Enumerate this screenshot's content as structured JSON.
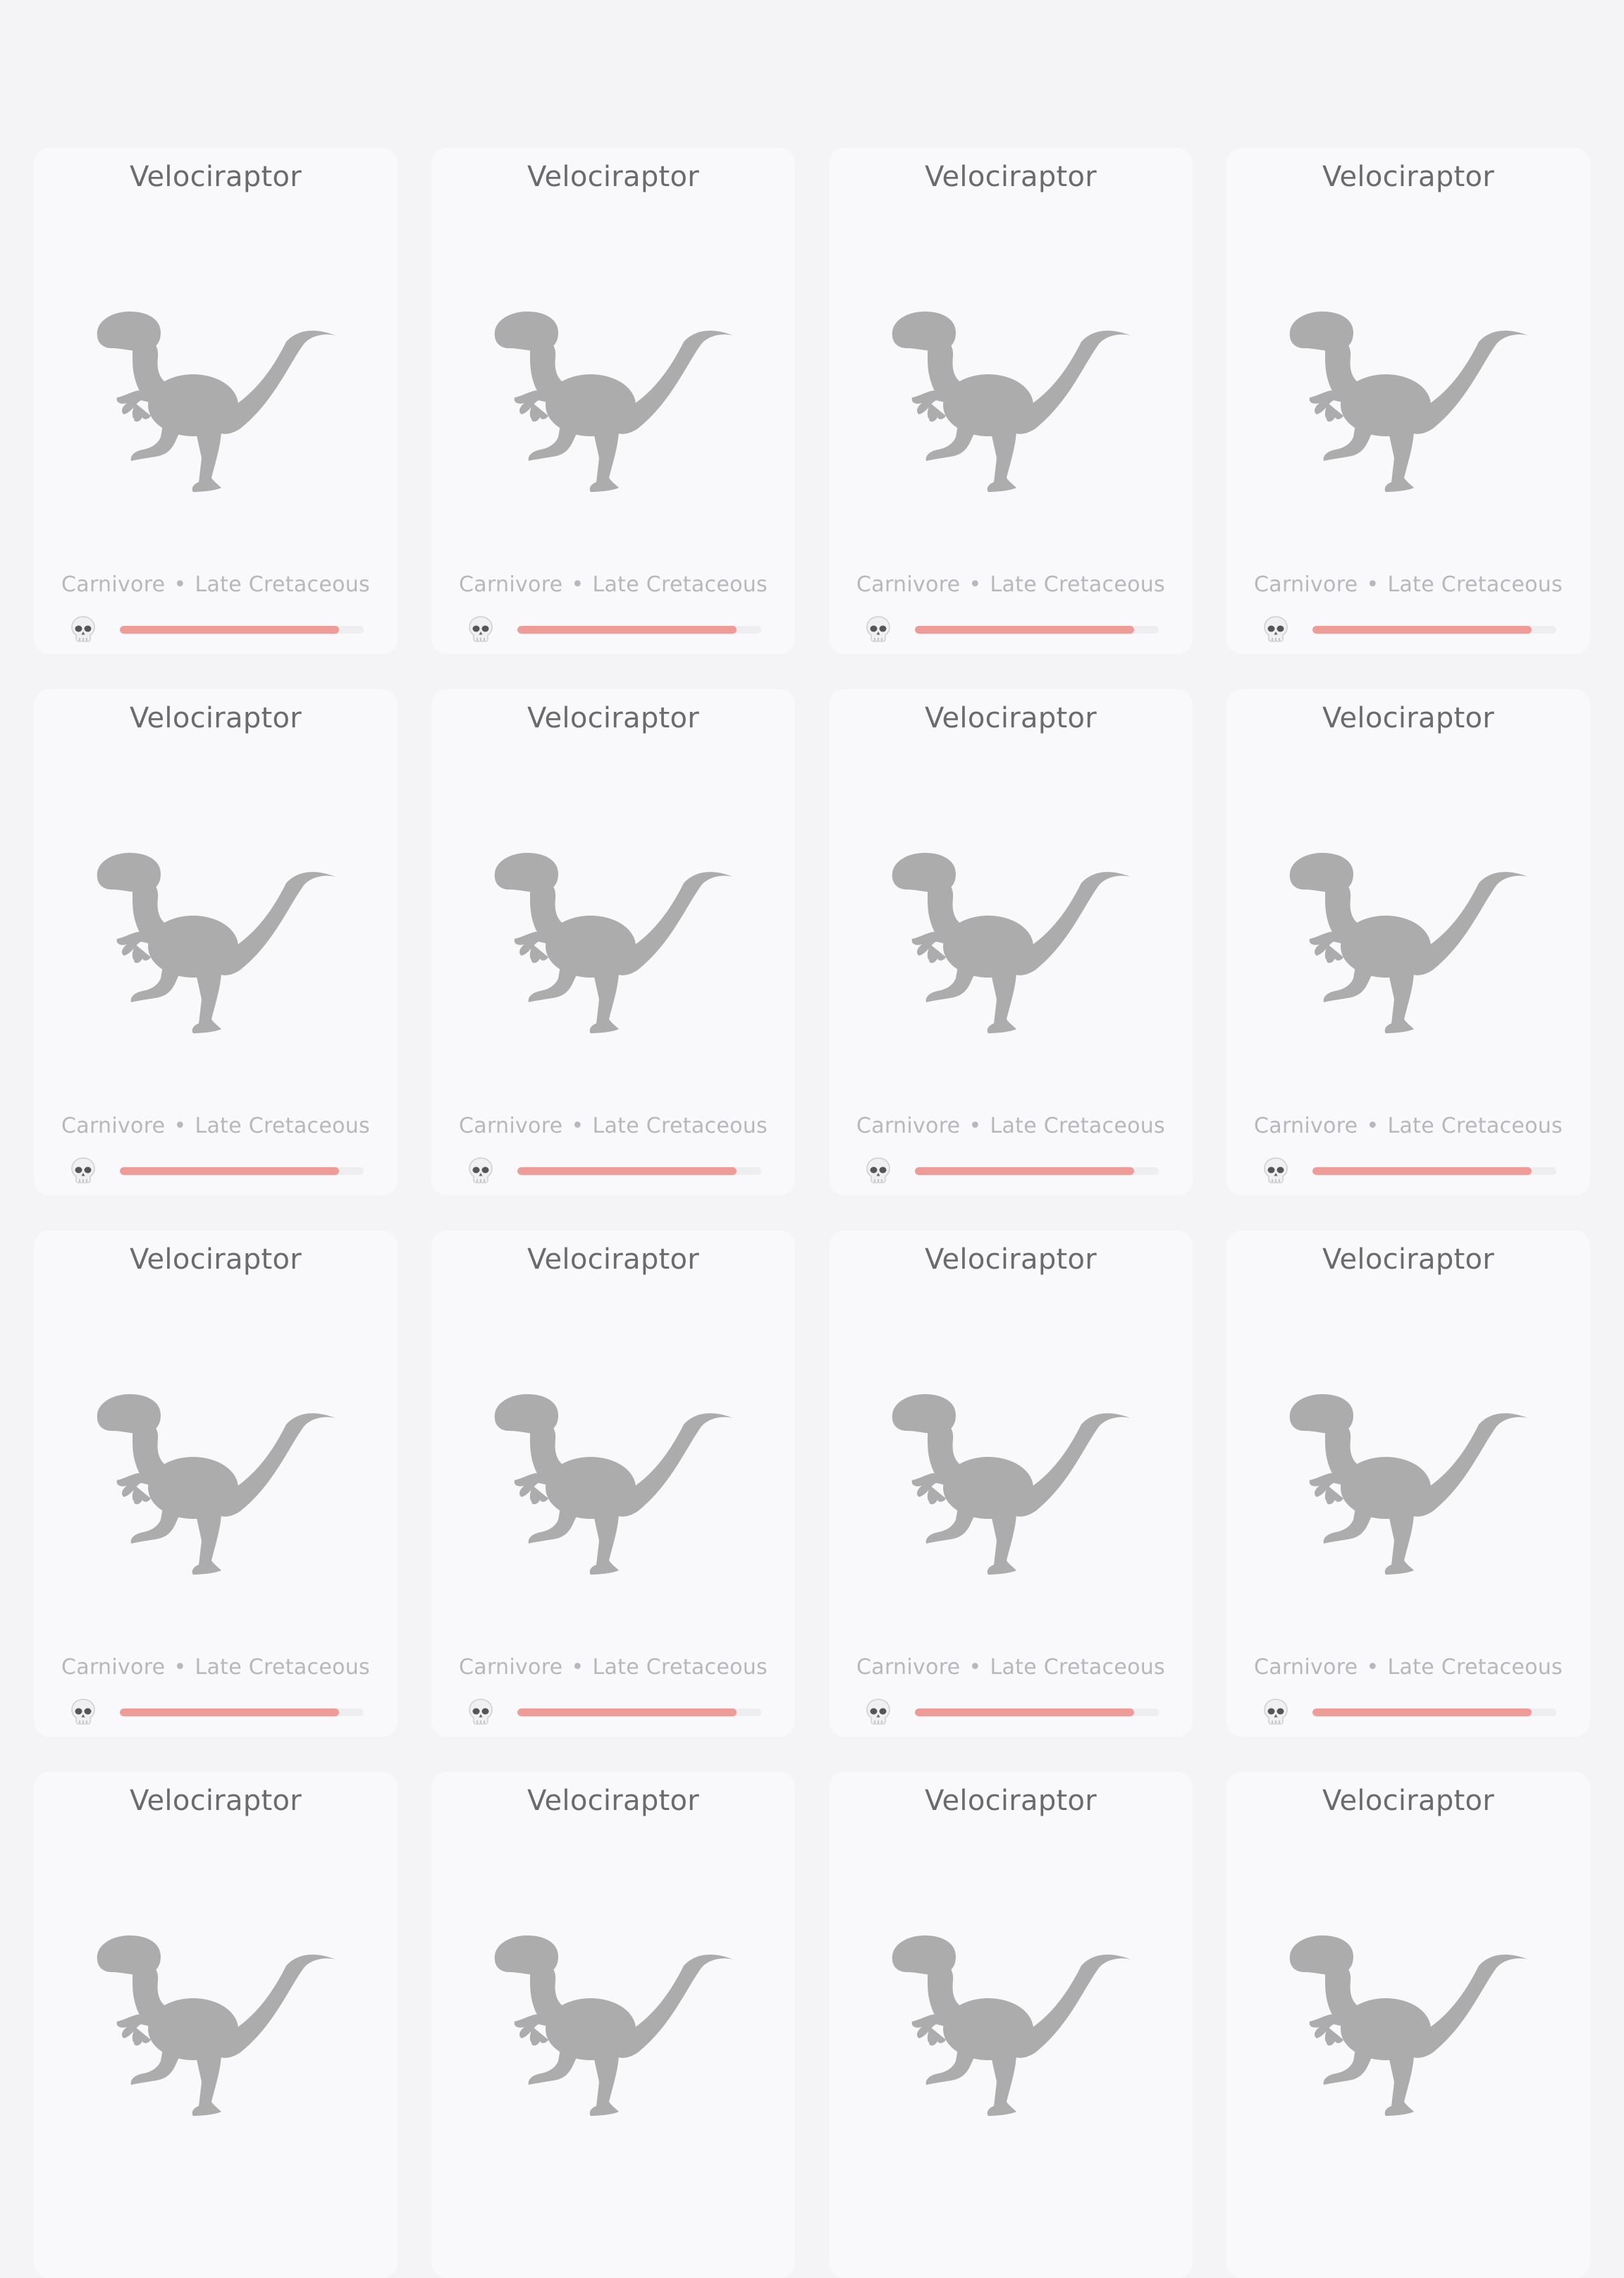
{
  "colors": {
    "background": "#f4f4f7",
    "card": "#f9f9fb",
    "title_text": "#6b6b6b",
    "meta_text": "#b8b8bc",
    "silhouette": "#acacac",
    "danger_bar_fill": "#ef9c99",
    "danger_bar_track": "#eeeef1"
  },
  "cards": [
    {
      "name": "Velociraptor",
      "diet": "Carnivore",
      "separator": "•",
      "period": "Late Cretaceous",
      "image_icon": "velociraptor-silhouette",
      "danger_icon": "skull-icon",
      "danger_level": 0.9
    },
    {
      "name": "Velociraptor",
      "diet": "Carnivore",
      "separator": "•",
      "period": "Late Cretaceous",
      "image_icon": "velociraptor-silhouette",
      "danger_icon": "skull-icon",
      "danger_level": 0.9
    },
    {
      "name": "Velociraptor",
      "diet": "Carnivore",
      "separator": "•",
      "period": "Late Cretaceous",
      "image_icon": "velociraptor-silhouette",
      "danger_icon": "skull-icon",
      "danger_level": 0.9
    },
    {
      "name": "Velociraptor",
      "diet": "Carnivore",
      "separator": "•",
      "period": "Late Cretaceous",
      "image_icon": "velociraptor-silhouette",
      "danger_icon": "skull-icon",
      "danger_level": 0.9
    },
    {
      "name": "Velociraptor",
      "diet": "Carnivore",
      "separator": "•",
      "period": "Late Cretaceous",
      "image_icon": "velociraptor-silhouette",
      "danger_icon": "skull-icon",
      "danger_level": 0.9
    },
    {
      "name": "Velociraptor",
      "diet": "Carnivore",
      "separator": "•",
      "period": "Late Cretaceous",
      "image_icon": "velociraptor-silhouette",
      "danger_icon": "skull-icon",
      "danger_level": 0.9
    },
    {
      "name": "Velociraptor",
      "diet": "Carnivore",
      "separator": "•",
      "period": "Late Cretaceous",
      "image_icon": "velociraptor-silhouette",
      "danger_icon": "skull-icon",
      "danger_level": 0.9
    },
    {
      "name": "Velociraptor",
      "diet": "Carnivore",
      "separator": "•",
      "period": "Late Cretaceous",
      "image_icon": "velociraptor-silhouette",
      "danger_icon": "skull-icon",
      "danger_level": 0.9
    },
    {
      "name": "Velociraptor",
      "diet": "Carnivore",
      "separator": "•",
      "period": "Late Cretaceous",
      "image_icon": "velociraptor-silhouette",
      "danger_icon": "skull-icon",
      "danger_level": 0.9
    },
    {
      "name": "Velociraptor",
      "diet": "Carnivore",
      "separator": "•",
      "period": "Late Cretaceous",
      "image_icon": "velociraptor-silhouette",
      "danger_icon": "skull-icon",
      "danger_level": 0.9
    },
    {
      "name": "Velociraptor",
      "diet": "Carnivore",
      "separator": "•",
      "period": "Late Cretaceous",
      "image_icon": "velociraptor-silhouette",
      "danger_icon": "skull-icon",
      "danger_level": 0.9
    },
    {
      "name": "Velociraptor",
      "diet": "Carnivore",
      "separator": "•",
      "period": "Late Cretaceous",
      "image_icon": "velociraptor-silhouette",
      "danger_icon": "skull-icon",
      "danger_level": 0.9
    },
    {
      "name": "Velociraptor",
      "image_icon": "velociraptor-silhouette"
    },
    {
      "name": "Velociraptor",
      "image_icon": "velociraptor-silhouette"
    },
    {
      "name": "Velociraptor",
      "image_icon": "velociraptor-silhouette"
    },
    {
      "name": "Velociraptor",
      "image_icon": "velociraptor-silhouette"
    }
  ]
}
